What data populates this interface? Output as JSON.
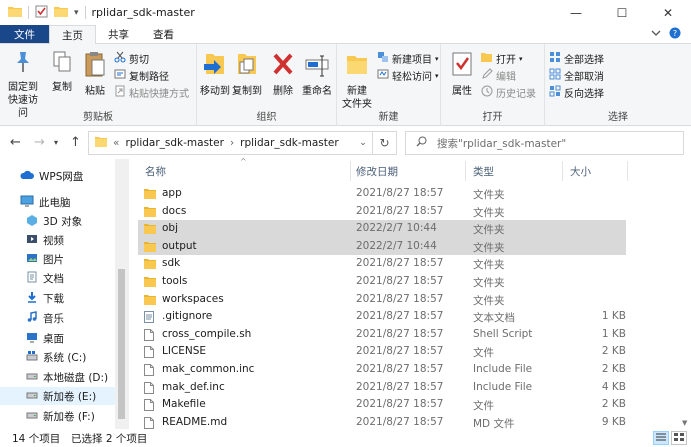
{
  "window": {
    "title": "rplidar_sdk-master",
    "minimize_glyph": "—",
    "maximize_glyph": "☐",
    "close_glyph": "✕",
    "quick_access_more": "▾"
  },
  "ribbon_tabs": [
    "文件",
    "主页",
    "共享",
    "查看"
  ],
  "ribbon": {
    "clipboard": {
      "label": "剪贴板",
      "pin": "固定到\n快速访问",
      "copy": "复制",
      "paste": "粘贴",
      "cut": "剪切",
      "copy_path": "复制路径",
      "paste_shortcut": "粘贴快捷方式"
    },
    "organize": {
      "label": "组织",
      "move_to": "移动到",
      "copy_to": "复制到",
      "delete": "删除",
      "rename": "重命名"
    },
    "new": {
      "label": "新建",
      "new_folder": "新建\n文件夹",
      "new_item": "新建项目",
      "easy_access": "轻松访问"
    },
    "open": {
      "label": "打开",
      "properties": "属性",
      "open": "打开",
      "edit": "编辑",
      "history": "历史记录"
    },
    "select": {
      "label": "选择",
      "select_all": "全部选择",
      "select_none": "全部取消",
      "invert": "反向选择"
    }
  },
  "address": {
    "prefix": "«",
    "crumbs": [
      "rplidar_sdk-master",
      "rplidar_sdk-master"
    ],
    "separator": "›",
    "search_placeholder": "搜索\"rplidar_sdk-master\""
  },
  "nav_pane": [
    {
      "label": "WPS网盘",
      "icon": "cloud-icon",
      "selected": false
    },
    {
      "label": "此电脑",
      "icon": "computer-icon",
      "selected": false
    },
    {
      "label": "3D 对象",
      "icon": "3d-objects-icon",
      "selected": false
    },
    {
      "label": "视频",
      "icon": "video-icon",
      "selected": false
    },
    {
      "label": "图片",
      "icon": "pictures-icon",
      "selected": false
    },
    {
      "label": "文档",
      "icon": "documents-icon",
      "selected": false
    },
    {
      "label": "下载",
      "icon": "downloads-icon",
      "selected": false
    },
    {
      "label": "音乐",
      "icon": "music-icon",
      "selected": false
    },
    {
      "label": "桌面",
      "icon": "desktop-icon",
      "selected": false
    },
    {
      "label": "系统 (C:)",
      "icon": "system-drive-icon",
      "selected": false
    },
    {
      "label": "本地磁盘 (D:)",
      "icon": "drive-icon",
      "selected": false
    },
    {
      "label": "新加卷 (E:)",
      "icon": "drive-icon",
      "selected": true
    },
    {
      "label": "新加卷 (F:)",
      "icon": "drive-icon",
      "selected": false
    }
  ],
  "columns": {
    "name": "名称",
    "date": "修改日期",
    "type": "类型",
    "size": "大小"
  },
  "files": [
    {
      "name": "app",
      "date": "2021/8/27 18:57",
      "type": "文件夹",
      "size": "",
      "kind": "folder",
      "selected": false
    },
    {
      "name": "docs",
      "date": "2021/8/27 18:57",
      "type": "文件夹",
      "size": "",
      "kind": "folder",
      "selected": false
    },
    {
      "name": "obj",
      "date": "2022/2/7 10:44",
      "type": "文件夹",
      "size": "",
      "kind": "folder",
      "selected": true
    },
    {
      "name": "output",
      "date": "2022/2/7 10:44",
      "type": "文件夹",
      "size": "",
      "kind": "folder",
      "selected": true
    },
    {
      "name": "sdk",
      "date": "2021/8/27 18:57",
      "type": "文件夹",
      "size": "",
      "kind": "folder",
      "selected": false
    },
    {
      "name": "tools",
      "date": "2021/8/27 18:57",
      "type": "文件夹",
      "size": "",
      "kind": "folder",
      "selected": false
    },
    {
      "name": "workspaces",
      "date": "2021/8/27 18:57",
      "type": "文件夹",
      "size": "",
      "kind": "folder",
      "selected": false
    },
    {
      "name": ".gitignore",
      "date": "2021/8/27 18:57",
      "type": "文本文档",
      "size": "1 KB",
      "kind": "text",
      "selected": false
    },
    {
      "name": "cross_compile.sh",
      "date": "2021/8/27 18:57",
      "type": "Shell Script",
      "size": "1 KB",
      "kind": "file",
      "selected": false
    },
    {
      "name": "LICENSE",
      "date": "2021/8/27 18:57",
      "type": "文件",
      "size": "2 KB",
      "kind": "file",
      "selected": false
    },
    {
      "name": "mak_common.inc",
      "date": "2021/8/27 18:57",
      "type": "Include File",
      "size": "2 KB",
      "kind": "file",
      "selected": false
    },
    {
      "name": "mak_def.inc",
      "date": "2021/8/27 18:57",
      "type": "Include File",
      "size": "4 KB",
      "kind": "file",
      "selected": false
    },
    {
      "name": "Makefile",
      "date": "2021/8/27 18:57",
      "type": "文件",
      "size": "2 KB",
      "kind": "file",
      "selected": false
    },
    {
      "name": "README.md",
      "date": "2021/8/27 18:57",
      "type": "MD 文件",
      "size": "9 KB",
      "kind": "file",
      "selected": false
    }
  ],
  "status": {
    "count": "14 个项目",
    "selected": "已选择 2 个项目"
  },
  "colors": {
    "file_tab": "#19478a",
    "folder": "#f8c850",
    "selection": "#d9d9d9",
    "nav_selection": "#e5f3ff",
    "header_text": "#4c607a"
  }
}
